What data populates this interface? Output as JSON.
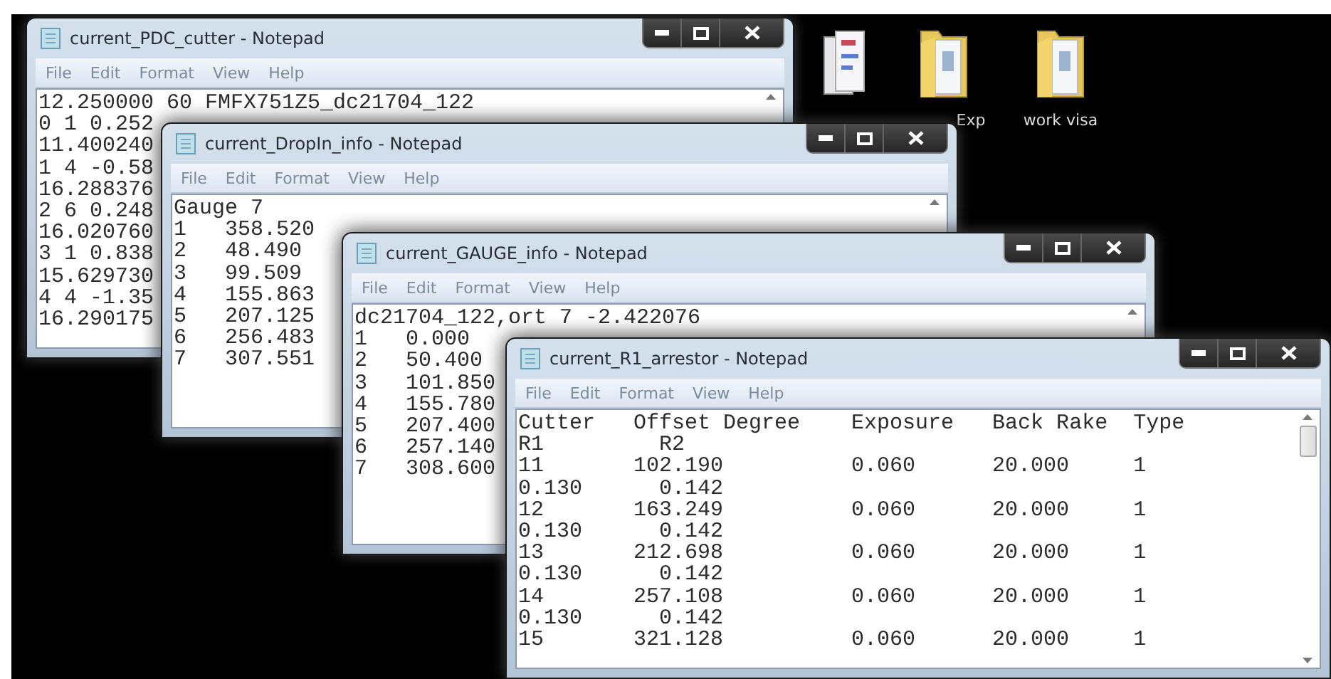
{
  "desktop_icons": [
    {
      "kind": "documents"
    },
    {
      "kind": "folder",
      "label": "Exp"
    },
    {
      "kind": "folder",
      "label": "work visa"
    }
  ],
  "windows": [
    {
      "title": "current_PDC_cutter - Notepad",
      "menu": [
        "File",
        "Edit",
        "Format",
        "View",
        "Help"
      ],
      "lines": [
        "12.250000 60 FMFX751Z5_dc21704_122",
        "0 1 0.252",
        "11.400240",
        "1 4 -0.58",
        "16.288376",
        "2 6 0.248",
        "16.020760",
        "3 1 0.838",
        "15.629730",
        "4 4 -1.35",
        "16.290175"
      ]
    },
    {
      "title": "current_DropIn_info - Notepad",
      "menu": [
        "File",
        "Edit",
        "Format",
        "View",
        "Help"
      ],
      "lines": [
        "Gauge 7",
        "1   358.520",
        "2   48.490",
        "3   99.509",
        "4   155.863",
        "5   207.125",
        "6   256.483",
        "7   307.551"
      ]
    },
    {
      "title": "current_GAUGE_info - Notepad",
      "menu": [
        "File",
        "Edit",
        "Format",
        "View",
        "Help"
      ],
      "lines": [
        "dc21704_122,ort 7 -2.422076",
        "1   0.000",
        "2   50.400",
        "3   101.850",
        "4   155.780",
        "5   207.400",
        "6   257.140",
        "7   308.600"
      ]
    },
    {
      "title": "current_R1_arrestor - Notepad",
      "menu": [
        "File",
        "Edit",
        "Format",
        "View",
        "Help"
      ],
      "lines": [
        "Cutter   Offset Degree    Exposure   Back Rake  Type",
        "R1         R2",
        "11       102.190          0.060      20.000     1",
        "0.130      0.142",
        "12       163.249          0.060      20.000     1",
        "0.130      0.142",
        "13       212.698          0.060      20.000     1",
        "0.130      0.142",
        "14       257.108          0.060      20.000     1",
        "0.130      0.142",
        "15       321.128          0.060      20.000     1"
      ]
    }
  ]
}
